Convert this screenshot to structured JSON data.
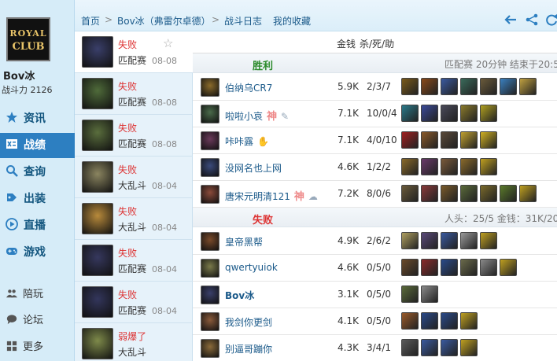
{
  "sidebar": {
    "logo_line1": "ROYAL",
    "logo_line2": "CLUB",
    "player_name": "Bov冰",
    "power_label": "战斗力 2126",
    "nav": [
      {
        "label": "资讯",
        "icon": "star-icon"
      },
      {
        "label": "战绩",
        "icon": "record-icon"
      },
      {
        "label": "查询",
        "icon": "search-icon"
      },
      {
        "label": "出装",
        "icon": "equip-icon"
      },
      {
        "label": "直播",
        "icon": "play-icon"
      },
      {
        "label": "游戏",
        "icon": "gamepad-icon"
      }
    ],
    "nav2": [
      {
        "label": "陪玩",
        "icon": "people-icon"
      },
      {
        "label": "论坛",
        "icon": "chat-icon"
      },
      {
        "label": "更多",
        "icon": "grid-icon"
      }
    ]
  },
  "topbar": {
    "crumbs": [
      "首页",
      "Bov冰（弗雷尔卓德）",
      "战斗日志",
      "我的收藏"
    ],
    "separator": ">"
  },
  "matches": [
    {
      "result": "失败",
      "mode": "匹配赛",
      "date": "08-08",
      "starred": true,
      "avatar_color": "#3a3f6a"
    },
    {
      "result": "失败",
      "mode": "匹配赛",
      "date": "08-08",
      "avatar_color": "#4f6b3a"
    },
    {
      "result": "失败",
      "mode": "匹配赛",
      "date": "08-08",
      "avatar_color": "#5a6e3d"
    },
    {
      "result": "失败",
      "mode": "大乱斗",
      "date": "08-04",
      "avatar_color": "#8b8560"
    },
    {
      "result": "失败",
      "mode": "大乱斗",
      "date": "08-04",
      "avatar_color": "#b88a3b"
    },
    {
      "result": "失败",
      "mode": "匹配赛",
      "date": "08-04",
      "avatar_color": "#36385e"
    },
    {
      "result": "失败",
      "mode": "匹配赛",
      "date": "08-04",
      "avatar_color": "#33365c"
    },
    {
      "result": "弱爆了",
      "mode": "大乱斗",
      "date": "",
      "avatar_color": "#7e8a4a"
    }
  ],
  "detail": {
    "col_gold": "金钱",
    "col_kda": "杀/死/助",
    "win_team": {
      "label": "胜利",
      "info": "匹配赛 20分钟 结束于20:5"
    },
    "lose_team": {
      "label": "失败",
      "info": "人头：25/5 金钱：31K/20"
    },
    "win_players": [
      {
        "name": "伯纳乌CR7",
        "gold": "5.9K",
        "kda": "2/3/7",
        "badge": "",
        "avatar": "#8a6a2a",
        "items": [
          "#7a5a1a",
          "#8a4a1a",
          "#3a5aa0",
          "#3a6a5a",
          "#6a5a3a",
          "#3a80c0",
          "#c0a040"
        ]
      },
      {
        "name": "啦啦小哀",
        "gold": "7.1K",
        "kda": "10/0/4",
        "badge": "神",
        "badge2": "✎",
        "avatar": "#4a6a4a",
        "items": [
          "#2a7a8a",
          "#3a4a9a",
          "#4a4a5a",
          "#8a7a2a",
          "#b0a020"
        ]
      },
      {
        "name": "咔咔露",
        "gold": "7.1K",
        "kda": "4/0/10",
        "badge": "",
        "badge2": "✋",
        "avatar": "#6a3a5a",
        "items": [
          "#a02020",
          "#8a5a2a",
          "#5a4a3a",
          "#c0a030",
          "#d0b020"
        ]
      },
      {
        "name": "没网名也上网",
        "gold": "4.6K",
        "kda": "1/2/2",
        "badge": "",
        "avatar": "#3a4a7a",
        "items": [
          "#8a6a2a",
          "#6a3a6a",
          "#7a5a3a",
          "#8a6a2a",
          "#c0a020"
        ]
      },
      {
        "name": "唐宋元明清121",
        "gold": "7.2K",
        "kda": "8/0/6",
        "badge": "神",
        "badge2": "☁",
        "avatar": "#8a4a3a",
        "items": [
          "#6a5a3a",
          "#8a3a3a",
          "#7a5a2a",
          "#5a6a3a",
          "#7a6a2a",
          "#5a7a2a",
          "#c0a020"
        ]
      }
    ],
    "lose_players": [
      {
        "name": "皇帝黑帮",
        "gold": "4.9K",
        "kda": "2/6/2",
        "avatar": "#7a4a2a",
        "items": [
          "#b0a060",
          "#5a4a7a",
          "#3a5aa0",
          "#9a9a9a",
          "#c0a020"
        ]
      },
      {
        "name": "qwertyuiok",
        "gold": "4.6K",
        "kda": "0/5/0",
        "avatar": "#7a7a4a",
        "items": [
          "#6a4a2a",
          "#8a2a2a",
          "#2a4a8a",
          "#6a6a4a",
          "#8a8a8a",
          "#c0a020"
        ]
      },
      {
        "name": "Bov冰",
        "gold": "3.1K",
        "kda": "0/5/0",
        "avatar": "#3a3f6a",
        "items": [
          "#5a6a3a",
          "#8a8a8a"
        ],
        "highlight": true
      },
      {
        "name": "我剑你更剑",
        "gold": "4.1K",
        "kda": "0/5/0",
        "avatar": "#8a5a3a",
        "items": [
          "#9a5a2a",
          "#2a4a8a",
          "#2a4a8a",
          "#c0a020"
        ]
      },
      {
        "name": "别逼哥蹦你",
        "gold": "4.3K",
        "kda": "3/4/1",
        "avatar": "#8a6a3a",
        "items": [
          "#5a5a5a",
          "#3a5aa0",
          "#3a5aa0",
          "#c0a020"
        ]
      }
    ]
  },
  "colors": {
    "accent": "#2d7fc1",
    "link": "#1b5a8a",
    "loss": "#d33",
    "win_green": "#2a8a2a",
    "loss_red": "#d33"
  }
}
